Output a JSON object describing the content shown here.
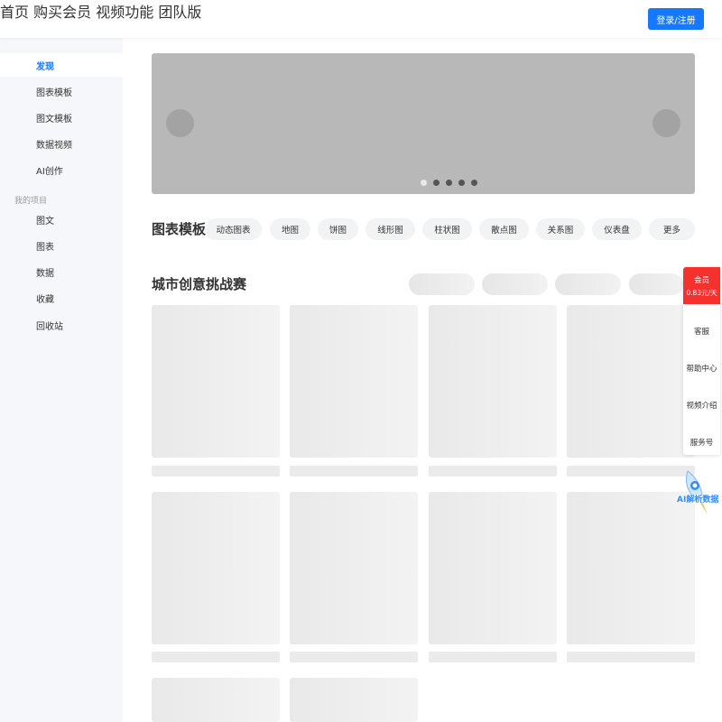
{
  "header": {
    "nav": [
      "首页",
      "购买会员",
      "视频功能",
      "团队版"
    ],
    "login_label": "登录/注册",
    "accent_color": "#1677ff"
  },
  "sidebar": {
    "items": [
      {
        "label": "发现",
        "active": true
      },
      {
        "label": "图表模板"
      },
      {
        "label": "图文模板"
      },
      {
        "label": "数据视频"
      },
      {
        "label": "AI创作"
      }
    ],
    "group_label": "我的项目",
    "project_items": [
      {
        "label": "图文"
      },
      {
        "label": "图表"
      },
      {
        "label": "数据"
      },
      {
        "label": "收藏"
      },
      {
        "label": "回收站"
      }
    ]
  },
  "banner": {
    "slide_count": 5,
    "active_slide": 1,
    "left_icon": "chevron-left-icon",
    "right_icon": "chevron-right-icon"
  },
  "templates": {
    "title": "图表模板",
    "chips": [
      "动态图表",
      "地图",
      "饼图",
      "线形图",
      "柱状图",
      "散点图",
      "关系图",
      "仪表盘",
      "更多"
    ]
  },
  "challenge": {
    "title": "城市创意挑战赛",
    "filter_count": 4,
    "card_count": 10
  },
  "float_panel": {
    "vip_label": "会员",
    "vip_price": "0.83元/天",
    "vip_color": "#f5312d",
    "items": [
      "客服",
      "帮助中心",
      "视频介绍",
      "服务号"
    ]
  },
  "ai_badge": {
    "label": "AI解析数据",
    "icon": "rocket-icon"
  }
}
